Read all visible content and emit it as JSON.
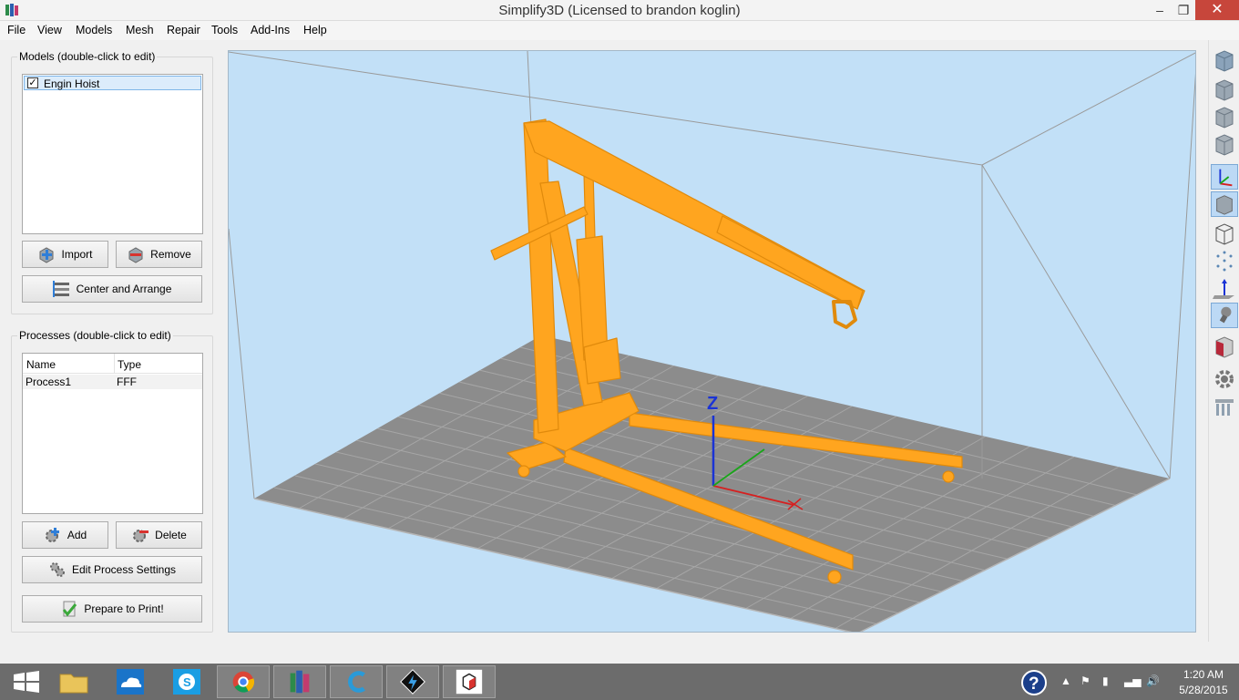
{
  "window": {
    "title": "Simplify3D (Licensed to brandon koglin)"
  },
  "menu": [
    "File",
    "View",
    "Models",
    "Mesh",
    "Repair",
    "Tools",
    "Add-Ins",
    "Help"
  ],
  "models_panel": {
    "title": "Models (double-click to edit)",
    "items": [
      {
        "label": "Engin Hoist",
        "checked": true
      }
    ],
    "import_label": "Import",
    "remove_label": "Remove",
    "center_label": "Center and Arrange"
  },
  "processes_panel": {
    "title": "Processes (double-click to edit)",
    "columns": [
      "Name",
      "Type"
    ],
    "rows": [
      {
        "name": "Process1",
        "type": "FFF"
      }
    ],
    "add_label": "Add",
    "delete_label": "Delete",
    "edit_label": "Edit Process Settings",
    "prepare_label": "Prepare to Print!"
  },
  "viewport": {
    "axis_z_label": "Z"
  },
  "right_toolbar": [
    "view-iso-icon",
    "view-front-icon",
    "view-side-icon",
    "view-top-icon",
    "axes-icon",
    "solid-view-icon",
    "wireframe-icon",
    "point-view-icon",
    "normals-icon",
    "lighting-icon",
    "cross-section-icon",
    "settings-gear-icon",
    "supports-icon"
  ],
  "taskbar": {
    "apps": [
      "windows-start-icon",
      "file-explorer-icon",
      "onedrive-icon",
      "skype-icon",
      "chrome-icon",
      "simplify3d-icon",
      "cura-icon",
      "flashprint-icon",
      "app-cube-icon"
    ],
    "time": "1:20 AM",
    "date": "5/28/2015"
  },
  "colors": {
    "accent": "#ffa51f",
    "viewport_bg": "#c2e0f7",
    "bed": "#8c8c8c",
    "close_button": "#c7463b"
  }
}
